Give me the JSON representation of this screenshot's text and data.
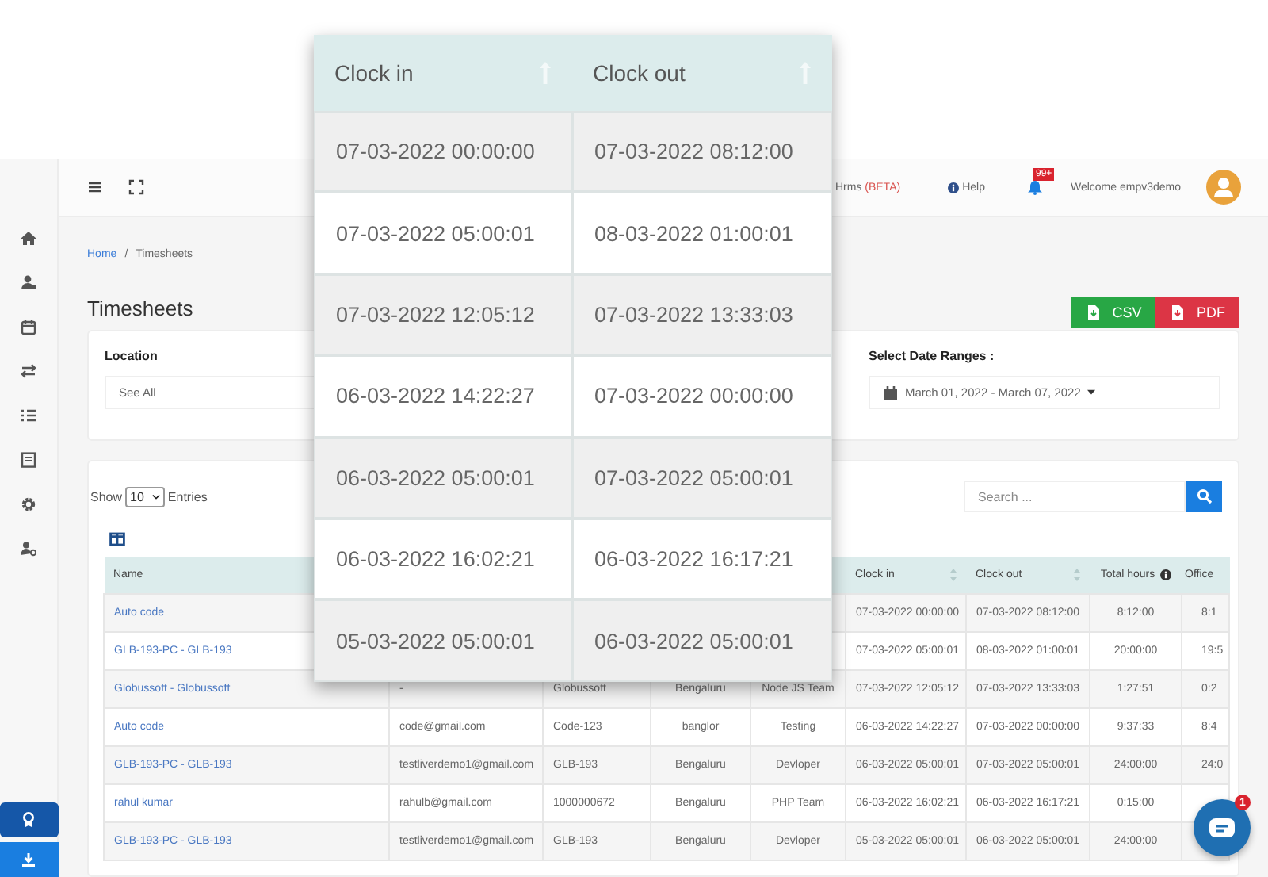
{
  "header": {
    "hrms_label": "Hrms",
    "hrms_tag": "(BETA)",
    "help": "Help",
    "notifications": "99+",
    "welcome": "Welcome  empv3demo"
  },
  "breadcrumb": {
    "items": [
      "Home",
      "Timesheets"
    ],
    "separator": "/"
  },
  "title": "Timesheets",
  "export_buttons": [
    {
      "label": "CSV",
      "color": "#28a745"
    },
    {
      "label": "PDF",
      "color": "#dc3545"
    }
  ],
  "filters": {
    "location": {
      "label": "Location",
      "value": "See All"
    },
    "date_range": {
      "label": "Select Date Ranges :",
      "value": "March 01, 2022 - March 07, 2022"
    }
  },
  "table_controls": {
    "show_label": "Show",
    "page_size": "10",
    "entries_label": "Entries",
    "search_placeholder": "Search ..."
  },
  "table": {
    "columns": [
      {
        "label": "Name",
        "sortable": false
      },
      {},
      {},
      {},
      {},
      {
        "label": "Clock in",
        "sortable": true
      },
      {
        "label": "Clock out",
        "sortable": true
      },
      {
        "label": "Total hours",
        "sortable": false,
        "info": true
      },
      {
        "label": "Office",
        "sortable": false
      }
    ],
    "rows": [
      [
        "Auto code",
        null,
        null,
        null,
        null,
        "07-03-2022 00:00:00",
        "07-03-2022 08:12:00",
        "8:12:00",
        "8:1"
      ],
      [
        "GLB-193-PC - GLB-193",
        null,
        null,
        null,
        null,
        "07-03-2022 05:00:01",
        "08-03-2022 01:00:01",
        "20:00:00",
        "19:5"
      ],
      [
        "Globussoft - Globussoft",
        "-",
        "Globussoft",
        "Bengaluru",
        "Node JS Team",
        "07-03-2022 12:05:12",
        "07-03-2022 13:33:03",
        "1:27:51",
        "0:2"
      ],
      [
        "Auto code",
        "code@gmail.com",
        "Code-123",
        "banglor",
        "Testing",
        "06-03-2022 14:22:27",
        "07-03-2022 00:00:00",
        "9:37:33",
        "8:4"
      ],
      [
        "GLB-193-PC - GLB-193",
        "testliverdemo1@gmail.com",
        "GLB-193",
        "Bengaluru",
        "Devloper",
        "06-03-2022 05:00:01",
        "07-03-2022 05:00:01",
        "24:00:00",
        "24:0"
      ],
      [
        "rahul kumar",
        "rahulb@gmail.com",
        "1000000672",
        "Bengaluru",
        "PHP Team",
        "06-03-2022 16:02:21",
        "06-03-2022 16:17:21",
        "0:15:00",
        null
      ],
      [
        "GLB-193-PC - GLB-193",
        "testliverdemo1@gmail.com",
        "GLB-193",
        "Bengaluru",
        "Devloper",
        "05-03-2022 05:00:01",
        "06-03-2022 05:00:01",
        "24:00:00",
        null
      ]
    ]
  },
  "magnified": {
    "columns": [
      {
        "label": "Clock in"
      },
      {
        "label": "Clock out"
      }
    ],
    "rows": [
      [
        "07-03-2022 00:00:00",
        "07-03-2022 08:12:00"
      ],
      [
        "07-03-2022 05:00:01",
        "08-03-2022 01:00:01"
      ],
      [
        "07-03-2022 12:05:12",
        "07-03-2022 13:33:03"
      ],
      [
        "06-03-2022 14:22:27",
        "07-03-2022 00:00:00"
      ],
      [
        "06-03-2022 05:00:01",
        "07-03-2022 05:00:01"
      ],
      [
        "06-03-2022 16:02:21",
        "06-03-2022 16:17:21"
      ],
      [
        "05-03-2022 05:00:01",
        "06-03-2022 05:00:01"
      ]
    ]
  },
  "chat": {
    "badge": "1"
  }
}
